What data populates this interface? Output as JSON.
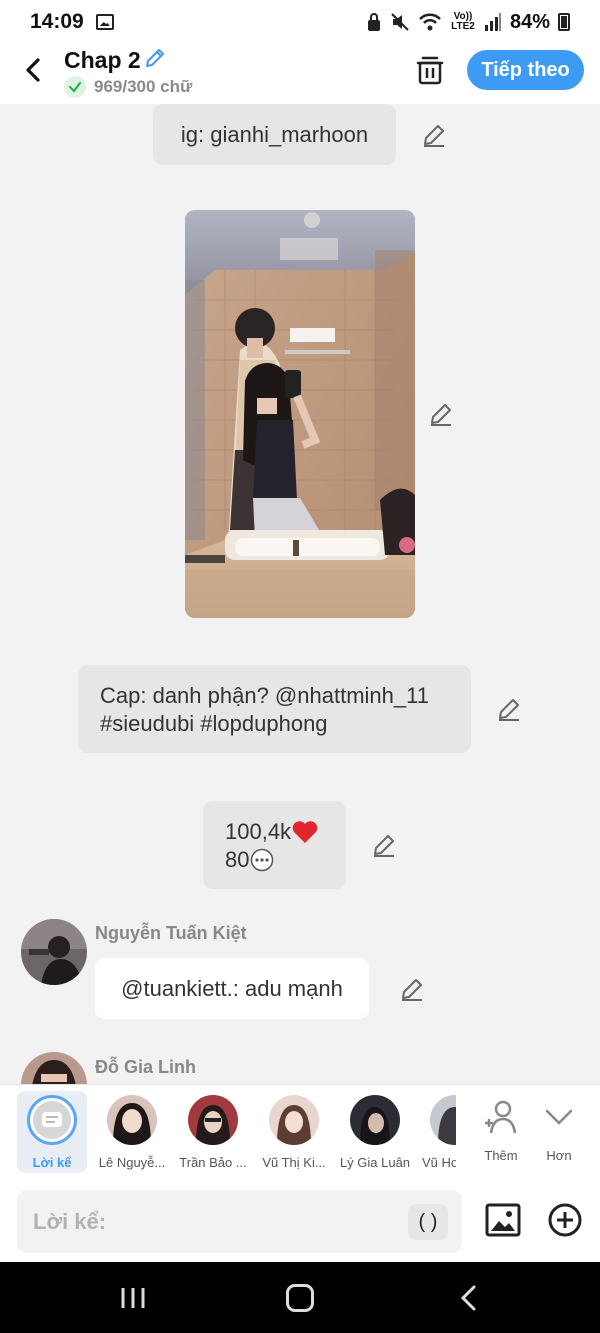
{
  "status_bar": {
    "time": "14:09",
    "network_label": "Vo)) LTE2",
    "battery": "84%"
  },
  "header": {
    "title": "Chap 2",
    "word_count": "969/300 chữ",
    "next_label": "Tiếp theo",
    "accent_color": "#3e9bf4"
  },
  "messages": {
    "ig_line": "ig: gianhi_marhoon",
    "caption_line1": "Cap: danh phận? @nhattminh_11",
    "caption_line2": "#sieudubi #lopduphong",
    "likes": "100,4k",
    "comments": "80",
    "speaker1_name": "Nguyễn Tuấn Kiệt",
    "speaker1_text": "@tuankiett.: adu mạnh",
    "speaker2_name": "Đỗ Gia Linh"
  },
  "character_bar": {
    "narrator_label": "Lời kể",
    "characters": [
      "Lê Nguyễ...",
      "Trần Bảo ...",
      "Vũ Thị Ki...",
      "Lý Gia Luân",
      "Vũ Ho"
    ],
    "add_label": "Thêm",
    "more_label": "Hơn"
  },
  "composer": {
    "placeholder": "Lời kể:",
    "paren_label": "( )"
  },
  "icons": {
    "back": "chevron-left-icon",
    "title_edit": "pencil-icon",
    "trash": "trash-icon",
    "edit": "pencil-icon",
    "image": "image-icon",
    "plus": "plus-circle-icon"
  }
}
